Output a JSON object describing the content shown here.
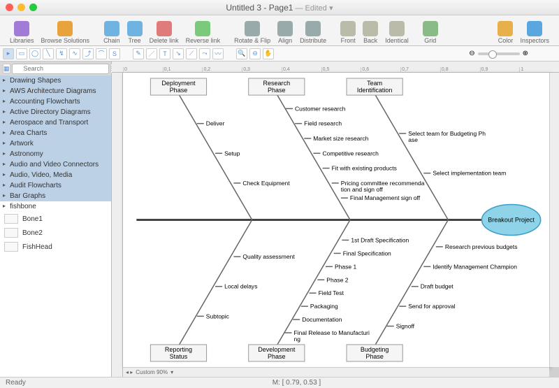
{
  "window": {
    "title": "Untitled 3 - Page1",
    "edited": " — Edited"
  },
  "toolbar": [
    {
      "label": "Libraries",
      "c": "#a27bd6"
    },
    {
      "label": "Browse Solutions",
      "c": "#e8a33d"
    },
    {
      "label": "",
      "sep": true
    },
    {
      "label": "Chain",
      "c": "#6fb3e0"
    },
    {
      "label": "Tree",
      "c": "#6fb3e0"
    },
    {
      "label": "Delete link",
      "c": "#e07b7b"
    },
    {
      "label": "Reverse link",
      "c": "#7bc97b"
    },
    {
      "label": "",
      "sep": true
    },
    {
      "label": "Rotate & Flip",
      "c": "#9aa"
    },
    {
      "label": "Align",
      "c": "#9aa"
    },
    {
      "label": "Distribute",
      "c": "#9aa"
    },
    {
      "label": "",
      "sep": true
    },
    {
      "label": "Front",
      "c": "#bba"
    },
    {
      "label": "Back",
      "c": "#bba"
    },
    {
      "label": "Identical",
      "c": "#bba"
    },
    {
      "label": "",
      "sep": true
    },
    {
      "label": "Grid",
      "c": "#8b8"
    },
    {
      "label": "",
      "flex": true
    },
    {
      "label": "Color",
      "c": "#e8b04a"
    },
    {
      "label": "Inspectors",
      "c": "#5aa7e0"
    }
  ],
  "search": {
    "placeholder": "Search"
  },
  "libraries": [
    "Drawing Shapes",
    "AWS Architecture Diagrams",
    "Accounting Flowcharts",
    "Active Directory Diagrams",
    "Aerospace and Transport",
    "Area Charts",
    "Artwork",
    "Astronomy",
    "Audio and Video Connectors",
    "Audio, Video, Media",
    "Audit Flowcharts",
    "Bar Graphs",
    "fishbone"
  ],
  "libSelected": 12,
  "shapes": [
    "Bone1",
    "Bone2",
    "FishHead"
  ],
  "zoom": "Custom 90%",
  "status": {
    "left": "Ready",
    "mid": "M: [ 0.79, 0.53 ]"
  },
  "ruler": [
    "0",
    "0,1",
    "0,2",
    "0,3",
    "0,4",
    "0,5",
    "0,6",
    "0,7",
    "0,8",
    "0,9",
    "1"
  ],
  "diagram": {
    "head": "Breakout Project",
    "topCats": [
      "Deployment Phase",
      "Research Phase",
      "Team Identification"
    ],
    "botCats": [
      "Reporting Status",
      "Development Phase",
      "Budgeting Phase"
    ],
    "top": {
      "deploy": [
        "Deliver",
        "Setup",
        "Check Equipment"
      ],
      "research": [
        "Customer research",
        "Field research",
        "Market size research",
        "Competitive research",
        "Fit with existing products",
        "Pricing committee recommendation and sign off",
        "Final Management sign off"
      ],
      "team": [
        "Select team for Budgeting Phase",
        "Select implementation team"
      ]
    },
    "bot": {
      "report": [
        "Subtopic",
        "Local delays",
        "Quality assessment"
      ],
      "dev": [
        "Final Release to Manufacturing",
        "Documentation",
        "Packaging",
        "Field Test",
        "Phase 2",
        "Phase 1",
        "Final Specification",
        "1st Draft Specification"
      ],
      "budget": [
        "Signoff",
        "Send for approval",
        "Draft budget",
        "Identify Management Champion",
        "Research previous budgets"
      ]
    }
  }
}
